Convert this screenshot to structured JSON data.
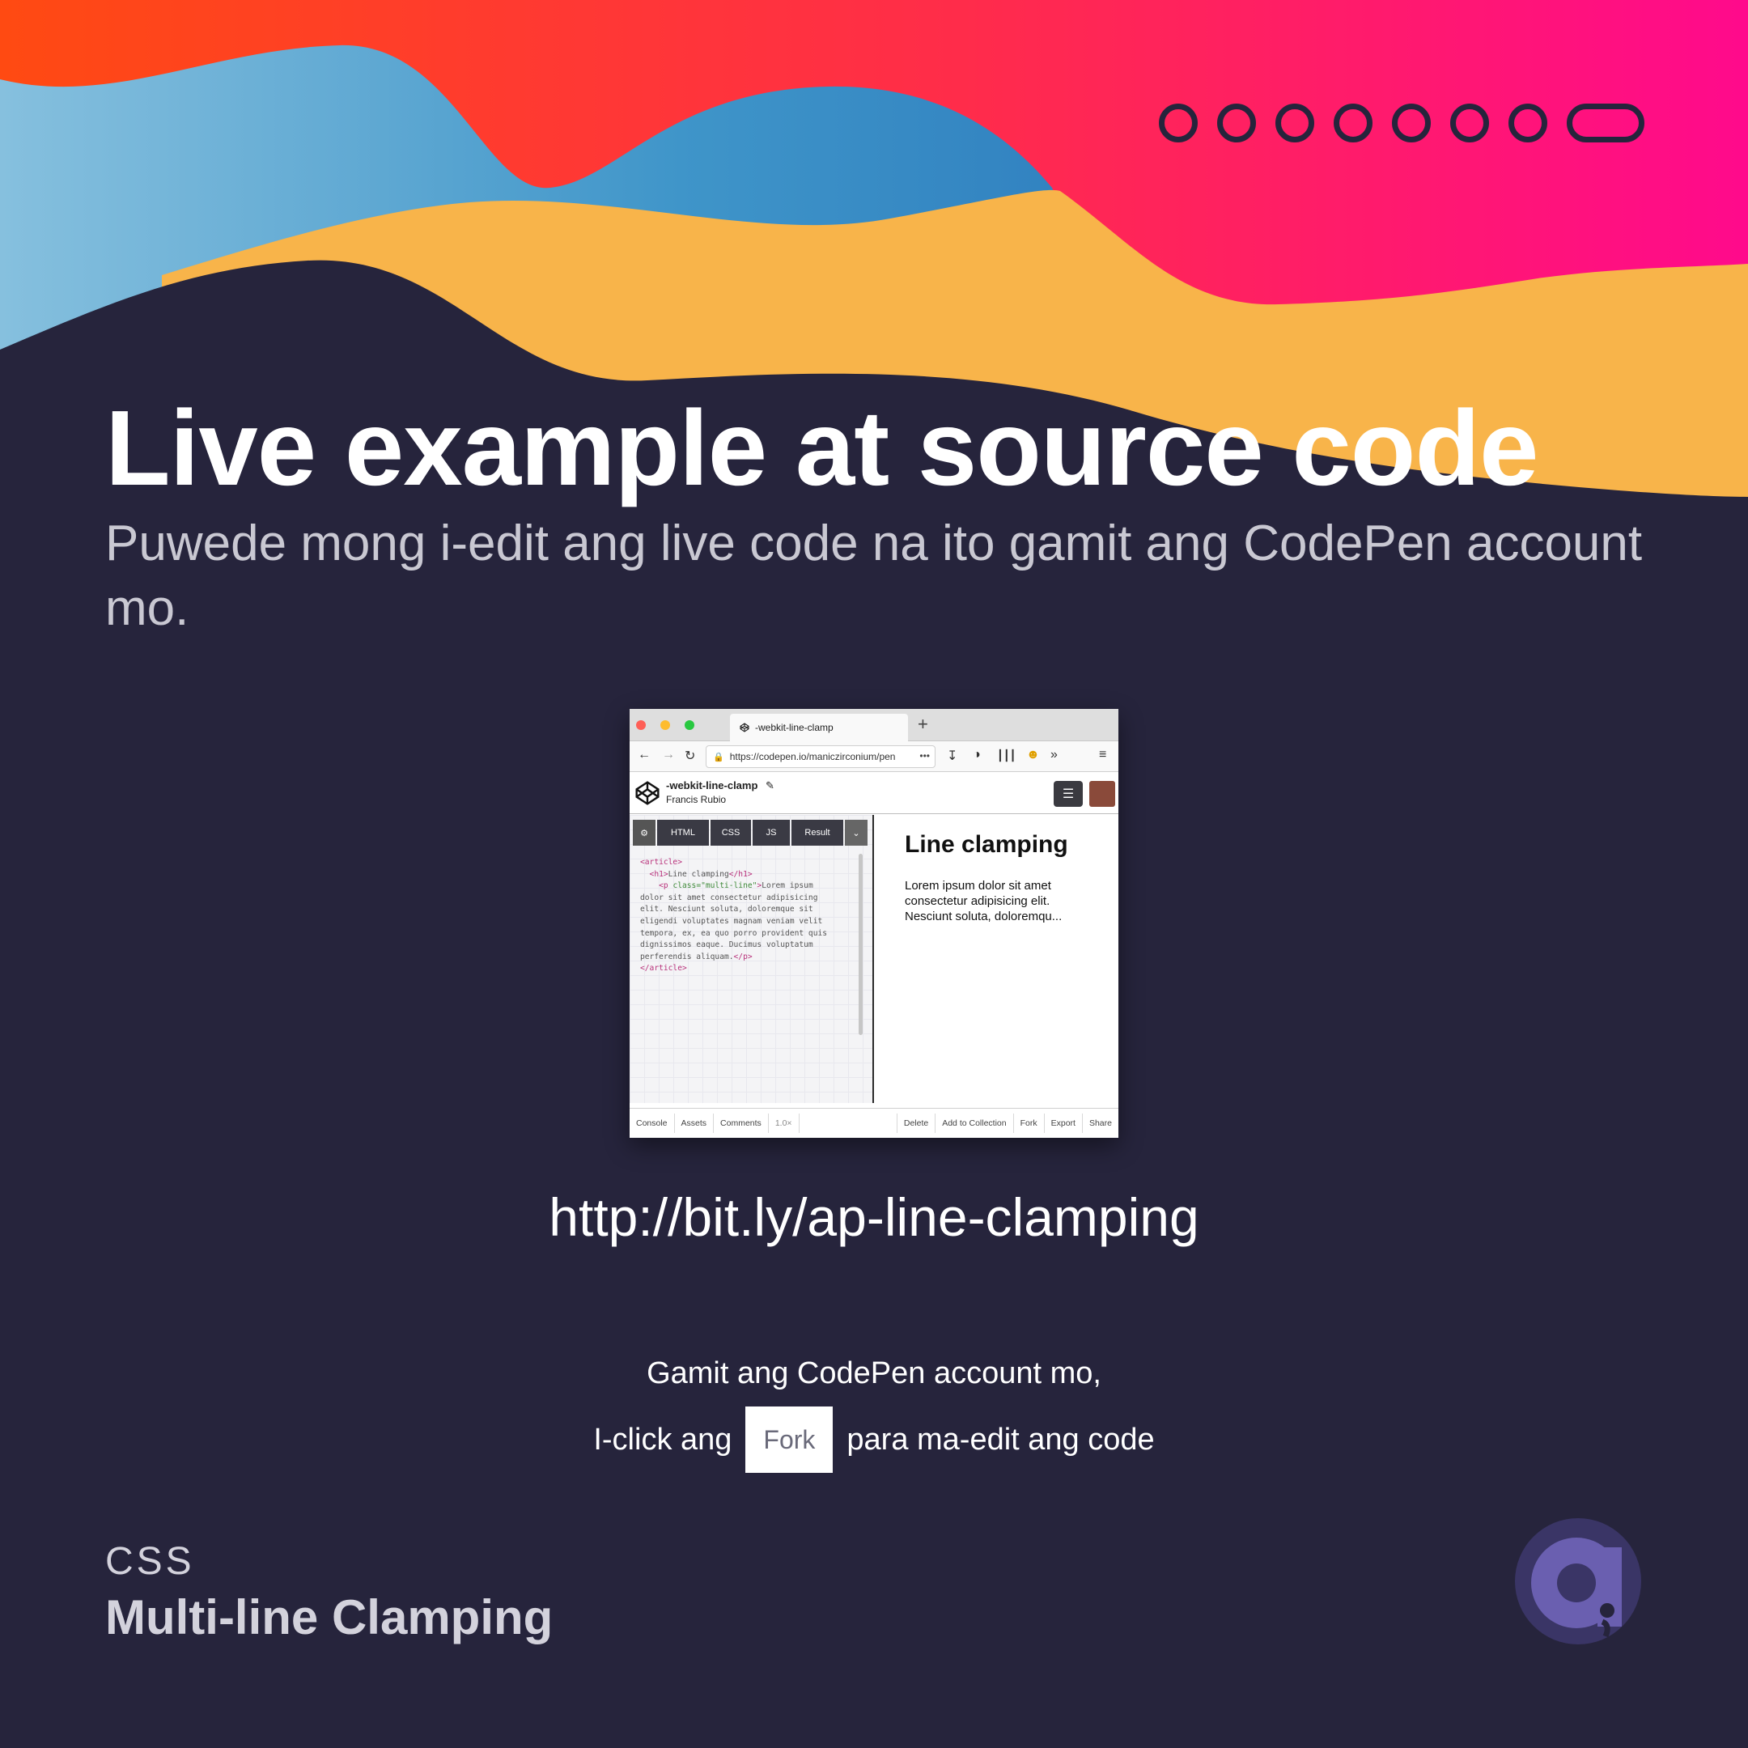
{
  "colors": {
    "background": "#26243c",
    "wave_orange": "#ff4a12",
    "wave_pink": "#ff1e6e",
    "wave_blue": "#5aa6d4",
    "wave_yellow": "#f8b44a",
    "accent_purple": "#6a5fb0"
  },
  "progress": {
    "total_slides": 8,
    "current_slide": 8
  },
  "headline": "Live example at source code",
  "subtitle": "Puwede mong i-edit ang live code na ito gamit ang CodePen account mo.",
  "screenshot": {
    "tab_title": "-webkit-line-clamp",
    "url": "https://codepen.io/maniczirconium/pen",
    "pen_title": "-webkit-line-clamp",
    "author": "Francis Rubio",
    "editor_tabs": [
      "HTML",
      "CSS",
      "JS",
      "Result"
    ],
    "code_lines": {
      "l1": "<article>",
      "l2a": "  <h1>",
      "l2b": "Line clamping",
      "l2c": "</h1>",
      "l3a": "    <p ",
      "l3b": "class=\"multi-line\"",
      "l3c": ">",
      "l3d": "Lorem ipsum",
      "l4": "dolor sit amet consectetur adipisicing",
      "l5": "elit. Nesciunt soluta, doloremque sit",
      "l6": "eligendi voluptates magnam veniam velit",
      "l7": "tempora, ex, ea quo porro provident quis",
      "l8": "dignissimos eaque. Ducimus voluptatum",
      "l9a": "perferendis aliquam.",
      "l9b": "</p>",
      "l10": "</article>"
    },
    "result_title": "Line clamping",
    "result_text": "Lorem ipsum dolor sit amet consectetur adipisicing elit. Nesciunt soluta, doloremqu...",
    "footer_left": [
      "Console",
      "Assets",
      "Comments",
      "1.0×"
    ],
    "footer_right": [
      "Delete",
      "Add to Collection",
      "Fork",
      "Export",
      "Share"
    ]
  },
  "link": "http://bit.ly/ap-line-clamping",
  "instruction": {
    "line1": "Gamit ang CodePen account mo,",
    "before": "I-click ang",
    "button": "Fork",
    "after": "para ma-edit ang code"
  },
  "footer": {
    "category": "CSS",
    "series": "Multi-line Clamping"
  }
}
